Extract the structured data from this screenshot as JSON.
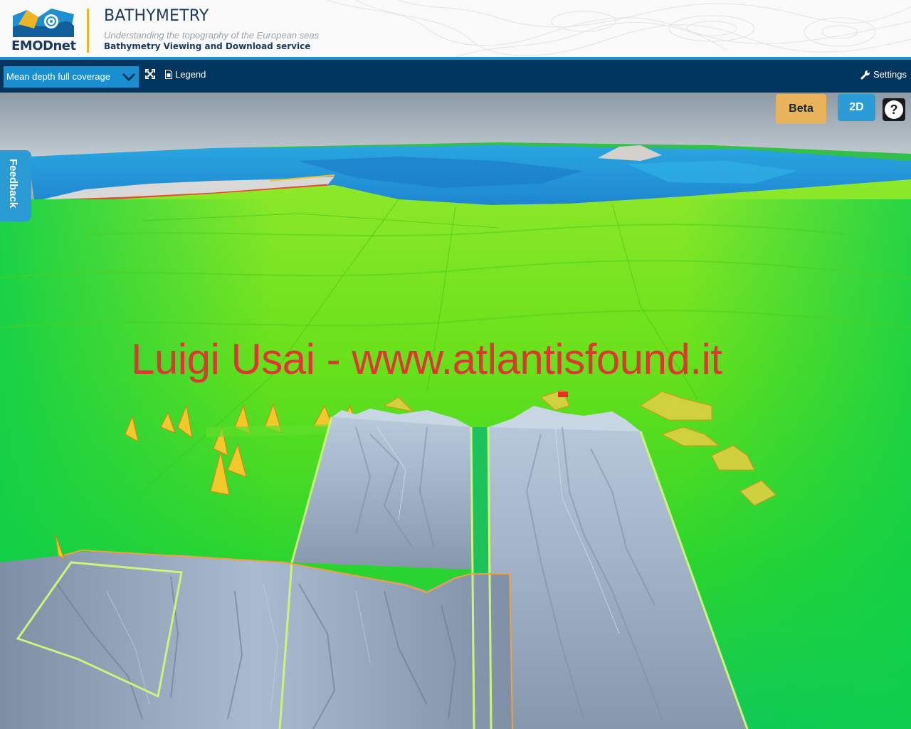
{
  "header": {
    "brand": "EMODnet",
    "title": "BATHYMETRY",
    "subtitle": "Understanding the topography of the European seas",
    "service": "Bathymetry Viewing and Download service"
  },
  "toolbar": {
    "layer_select": "Mean depth full coverage",
    "legend_label": "Legend",
    "settings_label": "Settings"
  },
  "map": {
    "beta_label": "Beta",
    "view_mode_label": "2D",
    "help_label": "?",
    "feedback_label": "Feedback",
    "watermark": "Luigi Usai - www.atlantisfound.it"
  },
  "colors": {
    "navy": "#00355f",
    "accent_blue": "#1a8fd0",
    "beta": "#e8b35a",
    "emodnet_orange": "#f0b323",
    "watermark": "#e03535"
  },
  "icons": [
    "emodnet-logo",
    "chevron-down-icon",
    "fullscreen-icon",
    "legend-icon",
    "wrench-icon",
    "help-icon"
  ]
}
